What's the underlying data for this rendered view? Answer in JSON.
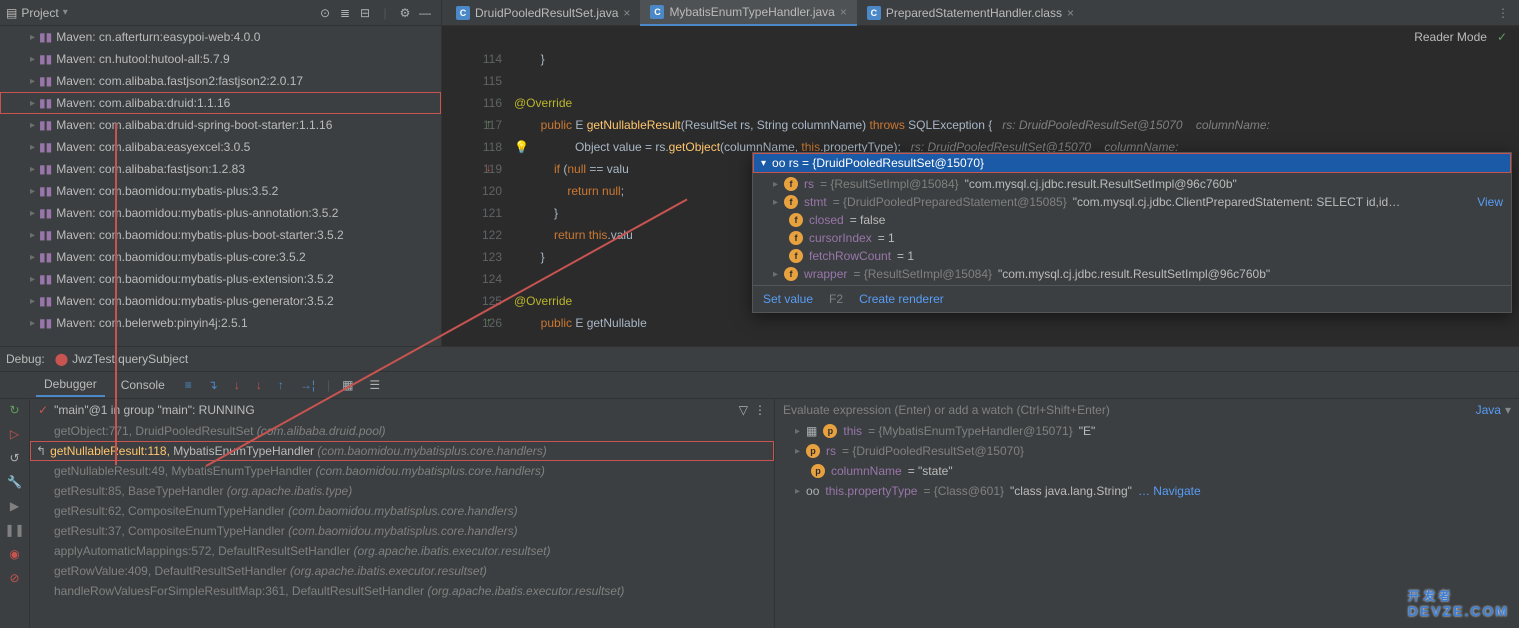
{
  "project": {
    "title": "Project",
    "items": [
      {
        "label": "Maven: cn.afterturn:easypoi-web:4.0.0"
      },
      {
        "label": "Maven: cn.hutool:hutool-all:5.7.9"
      },
      {
        "label": "Maven: com.alibaba.fastjson2:fastjson2:2.0.17"
      },
      {
        "label": "Maven: com.alibaba:druid:1.1.16",
        "hl": true
      },
      {
        "label": "Maven: com.alibaba:druid-spring-boot-starter:1.1.16"
      },
      {
        "label": "Maven: com.alibaba:easyexcel:3.0.5"
      },
      {
        "label": "Maven: com.alibaba:fastjson:1.2.83"
      },
      {
        "label": "Maven: com.baomidou:mybatis-plus:3.5.2"
      },
      {
        "label": "Maven: com.baomidou:mybatis-plus-annotation:3.5.2"
      },
      {
        "label": "Maven: com.baomidou:mybatis-plus-boot-starter:3.5.2"
      },
      {
        "label": "Maven: com.baomidou:mybatis-plus-core:3.5.2"
      },
      {
        "label": "Maven: com.baomidou:mybatis-plus-extension:3.5.2"
      },
      {
        "label": "Maven: com.baomidou:mybatis-plus-generator:3.5.2"
      },
      {
        "label": "Maven: com.belerweb:pinyin4j:2.5.1"
      }
    ]
  },
  "tabs": [
    {
      "label": "DruidPooledResultSet.java",
      "active": false
    },
    {
      "label": "MybatisEnumTypeHandler.java",
      "active": true
    },
    {
      "label": "PreparedStatementHandler.class",
      "active": false
    }
  ],
  "reader_mode": "Reader Mode",
  "code": {
    "lines": [
      {
        "n": 114,
        "txt": "        }"
      },
      {
        "n": 115,
        "txt": ""
      },
      {
        "n": 116,
        "txt": "        @Override",
        "anno": true
      },
      {
        "n": 117,
        "txt": "        public E getNullableResult(ResultSet rs, String columnName) throws SQLException {   rs: DruidPooledResultSet@15070    columnName:",
        "sig": true,
        "gicon": "↑"
      },
      {
        "n": 118,
        "txt": "            Object value = rs.getObject(columnName, this.propertyType);   rs: DruidPooledResultSet@15070    columnName:",
        "bulb": true
      },
      {
        "n": 119,
        "txt": "            if (null == valu",
        "gicon": "↓"
      },
      {
        "n": 120,
        "txt": "                return null;"
      },
      {
        "n": 121,
        "txt": "            }"
      },
      {
        "n": 122,
        "txt": "            return this.valu"
      },
      {
        "n": 123,
        "txt": "        }"
      },
      {
        "n": 124,
        "txt": ""
      },
      {
        "n": 125,
        "txt": "        @Override",
        "anno": true
      },
      {
        "n": 126,
        "txt": "        public E getNullable",
        "sig": true,
        "gicon": "↑"
      }
    ]
  },
  "popup": {
    "head": "oo rs = {DruidPooledResultSet@15070}",
    "rows": [
      {
        "chev": true,
        "badge": "f",
        "name": "rs",
        "gray": " = {ResultSetImpl@15084} ",
        "val": "\"com.mysql.cj.jdbc.result.ResultSetImpl@96c760b\""
      },
      {
        "chev": true,
        "badge": "f",
        "name": "stmt",
        "gray": " = {DruidPooledPreparedStatement@15085} ",
        "val": "\"com.mysql.cj.jdbc.ClientPreparedStatement: SELECT  id,id…",
        "link": "View"
      },
      {
        "badge": "f",
        "name": "closed",
        "val": " = false"
      },
      {
        "badge": "f",
        "name": "cursorIndex",
        "val": " = 1"
      },
      {
        "badge": "f",
        "name": "fetchRowCount",
        "val": " = 1"
      },
      {
        "chev": true,
        "badge": "f",
        "name": "wrapper",
        "gray": " = {ResultSetImpl@15084} ",
        "val": "\"com.mysql.cj.jdbc.result.ResultSetImpl@96c760b\""
      }
    ],
    "footer": {
      "set": "Set value",
      "hint": "F2",
      "render": "Create renderer"
    }
  },
  "debug": {
    "label": "Debug:",
    "config": "JwzTest.querySubject",
    "tool_tabs": {
      "debugger": "Debugger",
      "console": "Console"
    },
    "thread": "\"main\"@1 in group \"main\": RUNNING",
    "frames": [
      {
        "m": "getObject:771",
        "cls": "DruidPooledResultSet",
        "pkg": "(com.alibaba.druid.pool)"
      },
      {
        "m": "getNullableResult:118",
        "cls": "MybatisEnumTypeHandler",
        "pkg": "(com.baomidou.mybatisplus.core.handlers)",
        "sel": true
      },
      {
        "m": "getNullableResult:49",
        "cls": "MybatisEnumTypeHandler",
        "pkg": "(com.baomidou.mybatisplus.core.handlers)"
      },
      {
        "m": "getResult:85",
        "cls": "BaseTypeHandler",
        "pkg": "(org.apache.ibatis.type)"
      },
      {
        "m": "getResult:62",
        "cls": "CompositeEnumTypeHandler",
        "pkg": "(com.baomidou.mybatisplus.core.handlers)"
      },
      {
        "m": "getResult:37",
        "cls": "CompositeEnumTypeHandler",
        "pkg": "(com.baomidou.mybatisplus.core.handlers)"
      },
      {
        "m": "applyAutomaticMappings:572",
        "cls": "DefaultResultSetHandler",
        "pkg": "(org.apache.ibatis.executor.resultset)"
      },
      {
        "m": "getRowValue:409",
        "cls": "DefaultResultSetHandler",
        "pkg": "(org.apache.ibatis.executor.resultset)"
      },
      {
        "m": "handleRowValuesForSimpleResultMap:361",
        "cls": "DefaultResultSetHandler",
        "pkg": "(org.apache.ibatis.executor.resultset)"
      }
    ],
    "vars_placeholder": "Evaluate expression (Enter) or add a watch (Ctrl+Shift+Enter)",
    "vars_lang": "Java",
    "vars": [
      {
        "chev": true,
        "badge": "p",
        "glyph": "▦",
        "name": "this",
        "gray": " = {MybatisEnumTypeHandler@15071} ",
        "val": "\"E\""
      },
      {
        "chev": true,
        "badge": "p",
        "name": "rs",
        "gray": " = {DruidPooledResultSet@15070}"
      },
      {
        "badge": "p",
        "name": "columnName",
        "val": " = \"state\""
      },
      {
        "chev": true,
        "glyph": "oo",
        "name": "this.propertyType",
        "gray": " = {Class@601} ",
        "val": "\"class java.lang.String\"",
        "link": " … Navigate"
      }
    ]
  },
  "watermark": {
    "big": "开 发 者",
    "small": "DEVZE.COM"
  }
}
